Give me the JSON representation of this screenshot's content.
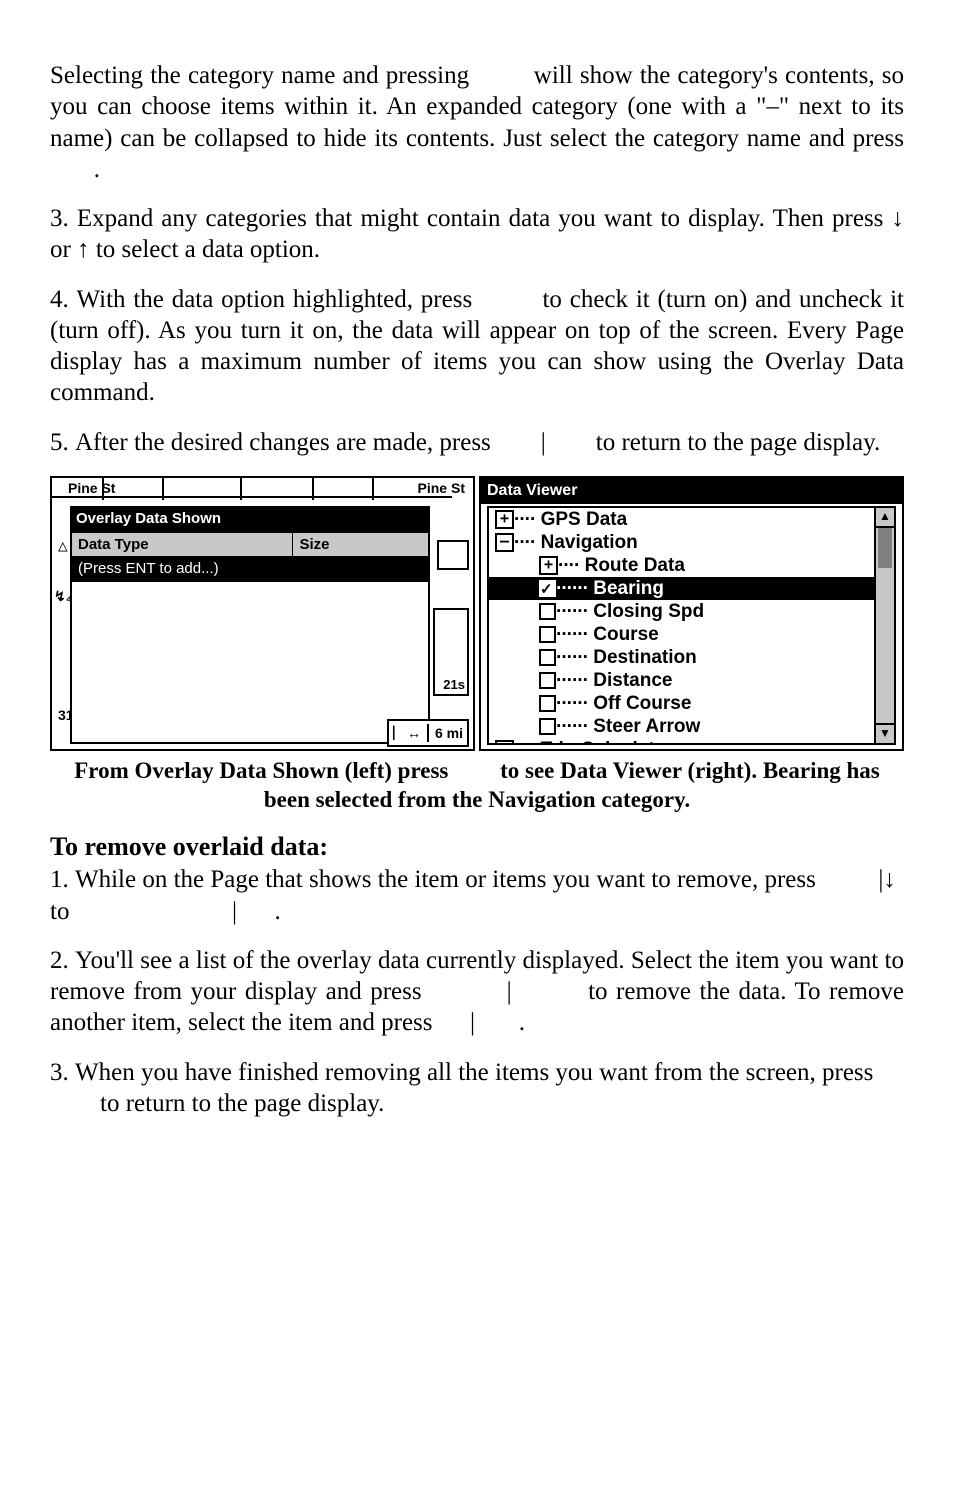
{
  "para1": "Selecting the category name and pressing         will show the category's contents, so you can choose items within it. An expanded category (one with a \"–\" next to its name) can be collapsed to hide its contents. Just select the category name and press        .",
  "para2": "3. Expand any categories that might contain data you want to display. Then press ↓ or ↑ to select a data option.",
  "para3": "4. With the data option highlighted, press         to check it (turn on) and uncheck it (turn off). As you turn it on, the data will appear on top of the screen. Every Page display has a maximum number of items you can show using the Overlay Data command.",
  "para4": "5. After the desired changes are made, press        |        to return to the page display.",
  "leftFig": {
    "bgTextLeft": "Pine St",
    "bgTextRight": "Pine St",
    "windowTitle": "Overlay Data Shown",
    "colA": "Data Type",
    "colB": "Size",
    "row2": "(Press ENT to add...)",
    "dataBoxTop": "",
    "dataBoxMid": "21s",
    "bottomMi": "6 mi",
    "marker31": "31"
  },
  "rightFig": {
    "title": "Data Viewer",
    "items": [
      {
        "indent": 0,
        "kind": "pm",
        "sym": "+",
        "label": "GPS Data",
        "dots": "····"
      },
      {
        "indent": 0,
        "kind": "pm",
        "sym": "–",
        "label": "Navigation",
        "dots": "····"
      },
      {
        "indent": 1,
        "kind": "pm",
        "sym": "+",
        "label": "Route Data",
        "dots": "····"
      },
      {
        "indent": 1,
        "kind": "chk",
        "checked": true,
        "sel": true,
        "label": "Bearing",
        "dots": "······"
      },
      {
        "indent": 1,
        "kind": "chk",
        "checked": false,
        "label": "Closing Spd",
        "dots": "······"
      },
      {
        "indent": 1,
        "kind": "chk",
        "checked": false,
        "label": "Course",
        "dots": "······"
      },
      {
        "indent": 1,
        "kind": "chk",
        "checked": false,
        "label": "Destination",
        "dots": "······"
      },
      {
        "indent": 1,
        "kind": "chk",
        "checked": false,
        "label": "Distance",
        "dots": "······"
      },
      {
        "indent": 1,
        "kind": "chk",
        "checked": false,
        "label": "Off Course",
        "dots": "······"
      },
      {
        "indent": 1,
        "kind": "chk",
        "checked": false,
        "label": "Steer Arrow",
        "dots": "······"
      },
      {
        "indent": 0,
        "kind": "pm",
        "sym": "+",
        "label": "Trip Calculator",
        "dots": "····"
      }
    ]
  },
  "caption1": "From Overlay Data Shown (left) press         to see Data Viewer (right). Bearing has been selected from the Navigation category.",
  "heading": "To remove overlaid data:",
  "para5": "1. While on the Page that shows the item or items you want to remove, press          |↓ to                          |      .",
  "para6": "2. You'll see a list of the overlay data currently displayed. Select the item you want to remove from your display and press          |         to remove the data. To remove another item, select the item and press      |       .",
  "para7": "3. When you have finished removing all the items you want from the screen, press         to return to the page display."
}
